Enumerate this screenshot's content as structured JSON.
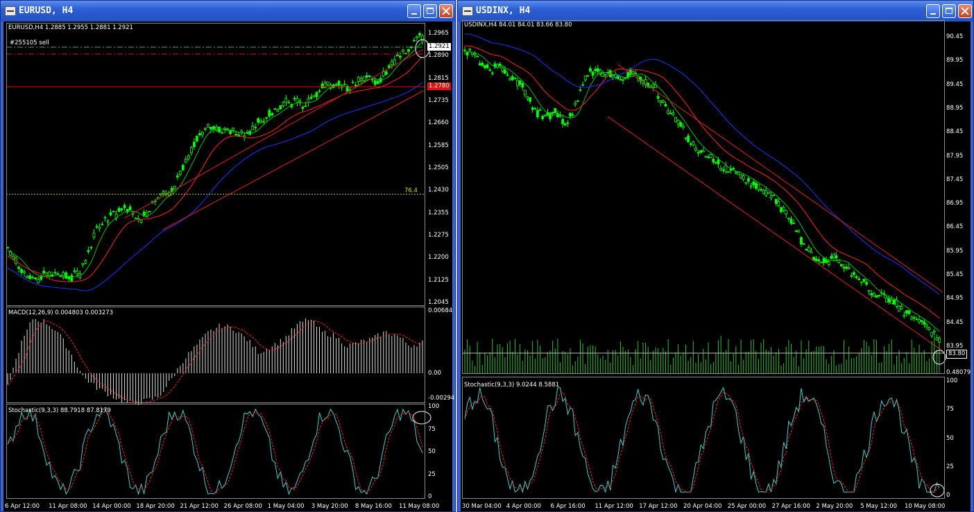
{
  "left_window": {
    "title": "EURUSD, H4",
    "header": "EURUSD,H4  1.2885 1.2955 1.2881 1.2921",
    "order_label": "#255105 sell",
    "fib_label": "76.4",
    "price_labels": [
      "1.2965",
      "1.2890",
      "1.2815",
      "1.2735",
      "1.2660",
      "1.2585",
      "1.2505",
      "1.2430",
      "1.2355",
      "1.2275",
      "1.2200",
      "1.2125",
      "1.2045"
    ],
    "current_price": "1.2921",
    "red_level_price": "1.2780",
    "macd_header": "MACD(12,26,9)  0.004803  0.003273",
    "macd_labels": [
      "0.00684",
      "0.00",
      "-0.00294"
    ],
    "stoch_header": "Stochastic(9,3,3)  88.7918  87.8179",
    "stoch_labels": [
      "100",
      "75",
      "50",
      "25",
      "0"
    ],
    "time_labels": [
      "6 Apr 12:00",
      "11 Apr 08:00",
      "14 Apr 00:00",
      "18 Apr 20:00",
      "21 Apr 12:00",
      "26 Apr 08:00",
      "1 May 04:00",
      "3 May 20:00",
      "8 May 16:00",
      "11 May 08:00"
    ]
  },
  "right_window": {
    "title": "USDINX, H4",
    "header": "USDINX,H4  84.01 84.01 83.66 83.80",
    "price_labels": [
      "90.45",
      "89.95",
      "89.45",
      "88.95",
      "88.45",
      "87.95",
      "87.45",
      "86.95",
      "86.45",
      "85.95",
      "85.45",
      "84.95",
      "84.45",
      "83.95"
    ],
    "current_price": "83.80",
    "volume_label": "0.48079",
    "stoch_header": "Stochastic(9,3,3)  9.0244  8.5881",
    "stoch_labels": [
      "100",
      "75",
      "50",
      "25",
      "0"
    ],
    "time_labels": [
      "30 Mar 04:00",
      "4 Apr 00:00",
      "6 Apr 16:00",
      "11 Apr 12:00",
      "17 Apr 12:00",
      "20 Apr 04:00",
      "25 Apr 00:00",
      "27 Apr 16:00",
      "2 May 20:00",
      "5 May 12:00",
      "10 May 08:00"
    ]
  },
  "colors": {
    "candle": "#00ff00",
    "ma_fast": "#00c000",
    "ma_mid": "#ff2020",
    "ma_slow": "#2030ff",
    "signal": "#ff2020",
    "stoch_main": "#40d0d0"
  }
}
